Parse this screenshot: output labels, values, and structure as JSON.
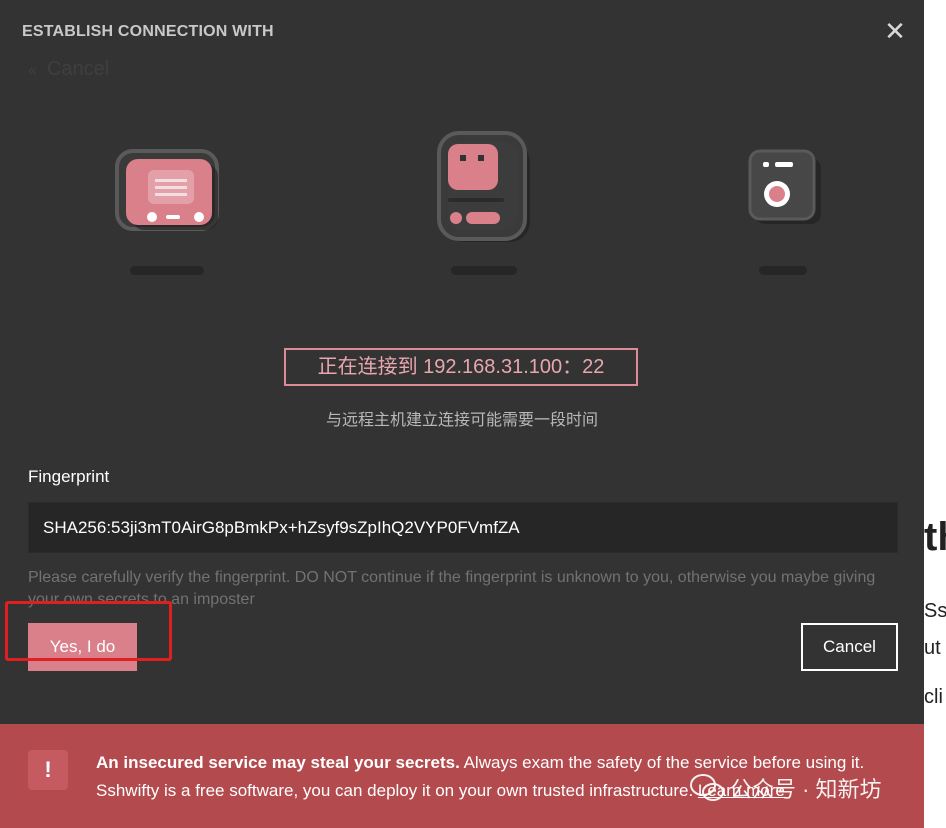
{
  "dialog": {
    "title": "ESTABLISH CONNECTION WITH",
    "close_icon": "close-icon",
    "back_label": "Cancel",
    "back_icon": "chevron-left-icon"
  },
  "illustration": {
    "icons": [
      "client-device-icon",
      "server-tablet-icon",
      "remote-device-icon"
    ]
  },
  "status": {
    "connecting_text": "正在连接到 192.168.31.100：22",
    "sub_text": "与远程主机建立连接可能需要一段时间"
  },
  "fingerprint": {
    "label": "Fingerprint",
    "value": "SHA256:53ji3mT0AirG8pBmkPx+hZsyf9sZpIhQ2VYP0FVmfZA",
    "warning": "Please carefully verify the fingerprint. DO NOT continue if the fingerprint is unknown to you, otherwise you maybe giving your own secrets to an imposter"
  },
  "buttons": {
    "confirm_label": "Yes, I do",
    "cancel_label": "Cancel"
  },
  "banner": {
    "icon_glyph": "!",
    "bold_text": "An insecured service may steal your secrets.",
    "text_1": " Always exam the safety of the service before using it.",
    "text_2": "Sshwifty is a free software, you can deploy it on your own trusted infrastructure. ",
    "learn_more": "Learn more"
  },
  "watermark": {
    "text": "公众号 · 知新坊"
  },
  "background_page": {
    "fragments": [
      "th",
      "Ss",
      "ut",
      "cli"
    ]
  },
  "colors": {
    "dialog_bg": "#333333",
    "accent_pink": "#d9808b",
    "banner_red": "#b24a4e",
    "highlight_red": "#e02020"
  }
}
